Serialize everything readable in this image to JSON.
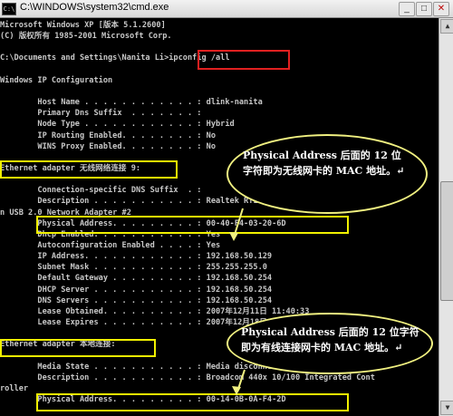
{
  "window": {
    "title": "C:\\WINDOWS\\system32\\cmd.exe",
    "app_icon": "cmd-icon",
    "icon_label": "C:\\",
    "minimize_label": "_",
    "maximize_label": "□",
    "close_label": "✕"
  },
  "console_lines": [
    "Microsoft Windows XP [版本 5.1.2600]",
    "(C) 版权所有 1985-2001 Microsoft Corp.",
    "",
    "C:\\Documents and Settings\\Nanita Li>ipconfig /all",
    "",
    "Windows IP Configuration",
    "",
    "        Host Name . . . . . . . . . . . . : dlink-nanita",
    "        Primary Dns Suffix  . . . . . . . :",
    "        Node Type . . . . . . . . . . . . : Hybrid",
    "        IP Routing Enabled. . . . . . . . : No",
    "        WINS Proxy Enabled. . . . . . . . : No",
    "",
    "Ethernet adapter 无线网络连接 9:",
    "",
    "        Connection-specific DNS Suffix  . :",
    "        Description . . . . . . . . . . . : Realtek RTL8192U Wireless LAN 802.11",
    "n USB 2.0 Network Adapter #2",
    "        Physical Address. . . . . . . . . : 00-40-F4-03-20-6D",
    "        Dhcp Enabled. . . . . . . . . . . : Yes",
    "        Autoconfiguration Enabled . . . . : Yes",
    "        IP Address. . . . . . . . . . . . : 192.168.50.129",
    "        Subnet Mask . . . . . . . . . . . : 255.255.255.0",
    "        Default Gateway . . . . . . . . . : 192.168.50.254",
    "        DHCP Server . . . . . . . . . . . : 192.168.50.254",
    "        DNS Servers . . . . . . . . . . . : 192.168.50.254",
    "        Lease Obtained. . . . . . . . . . : 2007年12月11日 11:40:33",
    "        Lease Expires . . . . . . . . . . : 2007年12月18日 11:40:33",
    "",
    "Ethernet adapter 本地连接:",
    "",
    "        Media State . . . . . . . . . . . : Media disconnected",
    "        Description . . . . . . . . . . . : Broadcom 440x 10/100 Integrated Cont",
    "roller",
    "        Physical Address. . . . . . . . . : 00-14-0B-0A-F4-2D"
  ],
  "annotations": {
    "wireless_note": "Physical Address 后面的 12 位字符即为无线网卡的 MAC 地址。↵",
    "wired_note": "Physical Address 后面的 12 位字符即为有线连接网卡的 MAC 地址。↵"
  },
  "colors": {
    "command_box": "#e02020",
    "highlight_box": "#f0f000",
    "bubble_border": "#f0f080"
  }
}
